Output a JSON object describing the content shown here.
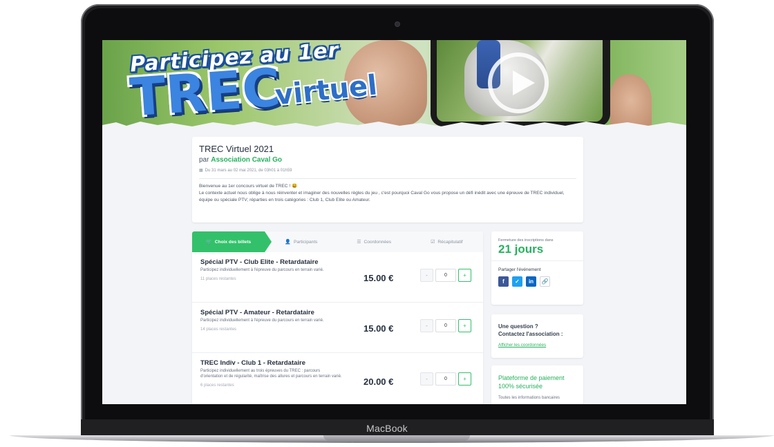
{
  "device": {
    "label": "MacBook"
  },
  "banner": {
    "line1": "Participez au 1er",
    "line2": "TREC",
    "line3": "virtuel"
  },
  "event": {
    "title": "TREC Virtuel 2021",
    "by_prefix": "par",
    "organizer": "Association Caval Go",
    "dates": "Du 31 mars au 02 mai 2021, de 03h01 à 01h59",
    "desc_line1": "Bienvenue au 1er concours virtuel de TREC ! 😃",
    "desc_line2": "Le contexte actuel nous oblige à nous réinventer et imaginer des nouvelles règles du jeu , c'est pourquoi Caval Go vous propose un défi inédit avec une épreuve de TREC individuel, équipe ou spéciale PTV; réparties en trois catégories : Club 1, Club Elite ou Amateur."
  },
  "steps": [
    {
      "label": "Choix des billets",
      "icon": "cart-icon"
    },
    {
      "label": "Participants",
      "icon": "user-icon"
    },
    {
      "label": "Coordonnées",
      "icon": "list-icon"
    },
    {
      "label": "Récapitulatif",
      "icon": "check-icon"
    }
  ],
  "tickets": [
    {
      "name": "Spécial PTV - Club Elite - Retardataire",
      "desc": "Participez individuellement à l'épreuve du parcours en terrain varié.",
      "remaining": "11 places restantes",
      "price": "15.00 €",
      "qty": "0"
    },
    {
      "name": "Spécial PTV - Amateur - Retardataire",
      "desc": "Participez individuellement à l'épreuve du parcours en terrain varié.",
      "remaining": "14 places restantes",
      "price": "15.00 €",
      "qty": "0"
    },
    {
      "name": "TREC Indiv - Club 1 - Retardataire",
      "desc": "Participez individuellement au trois épreuves du TREC : parcours d'orientation et de régularité, maîtrise des allures et parcours en terrain varié.",
      "remaining": "6 places restantes",
      "price": "20.00 €",
      "qty": "0"
    }
  ],
  "qty_buttons": {
    "minus": "-",
    "plus": "+"
  },
  "sidebar": {
    "closing_label": "Fermeture des inscriptions dans",
    "closing_value": "21 jours",
    "share_label": "Partager l'événement",
    "question_line1": "Une question ?",
    "question_line2": "Contactez l'association :",
    "contact_link": "Afficher les coordonnées",
    "payment_title": "Plateforme de paiement 100% sécurisée",
    "payment_desc": "Toutes les informations bancaires"
  },
  "colors": {
    "accent": "#32c16a",
    "text": "#27303f"
  }
}
